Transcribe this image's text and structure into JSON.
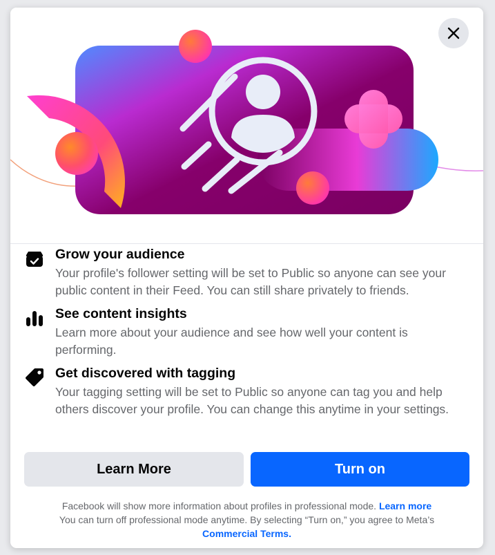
{
  "dialog": {
    "close_icon": "close-icon",
    "features": [
      {
        "icon": "storefront-icon",
        "title": "Grow your audience",
        "description": "Your profile's follower setting will be set to Public so anyone can see your public content in their Feed. You can still share privately to friends."
      },
      {
        "icon": "bar-chart-icon",
        "title": "See content insights",
        "description": "Learn more about your audience and see how well your content is performing."
      },
      {
        "icon": "tag-icon",
        "title": "Get discovered with tagging",
        "description": "Your tagging setting will be set to Public so anyone can tag you and help others discover your profile. You can change this anytime in your settings."
      }
    ],
    "buttons": {
      "learn_more": "Learn More",
      "turn_on": "Turn on"
    },
    "footer": {
      "line1": "Facebook will show more information about profiles in professional mode.",
      "line1_link": "Learn more",
      "line2": "You can turn off professional mode anytime. By selecting “Turn on,” you agree to Meta’s",
      "line3_link": "Commercial Terms."
    }
  },
  "colors": {
    "primary": "#0866ff",
    "secondary_button": "#e4e6eb",
    "text_primary": "#050505",
    "text_secondary": "#65676b"
  }
}
